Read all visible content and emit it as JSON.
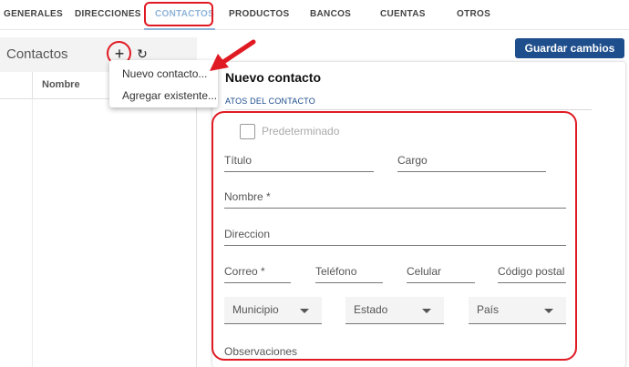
{
  "tabs": [
    {
      "label": "GENERALES"
    },
    {
      "label": "DIRECCIONES"
    },
    {
      "label": "CONTACTOS",
      "active": true
    },
    {
      "label": "PRODUCTOS"
    },
    {
      "label": "BANCOS"
    },
    {
      "label": "CUENTAS"
    },
    {
      "label": "OTROS"
    }
  ],
  "left_panel": {
    "title": "Contactos",
    "add_icon": "+",
    "refresh_icon": "↻",
    "column_name": "Nombre"
  },
  "menu": {
    "items": [
      "Nuevo contacto...",
      "Agregar existente..."
    ]
  },
  "toolbar": {
    "save_label": "Guardar cambios"
  },
  "form": {
    "title": "Nuevo contacto",
    "section": "ATOS DEL CONTACTO",
    "default_label": "Predeterminado",
    "fields": {
      "titulo": "Título",
      "cargo": "Cargo",
      "nombre": "Nombre *",
      "direccion": "Direccion",
      "correo": "Correo *",
      "telefono": "Teléfono",
      "celular": "Celular",
      "codigo_postal": "Código postal"
    },
    "selects": {
      "municipio": "Municipio",
      "estado": "Estado",
      "pais": "País"
    },
    "observaciones": "Observaciones"
  },
  "colors": {
    "accent": "#1f4e8c",
    "active_tab": "#8fb4d9",
    "highlight": "#e01a22"
  }
}
